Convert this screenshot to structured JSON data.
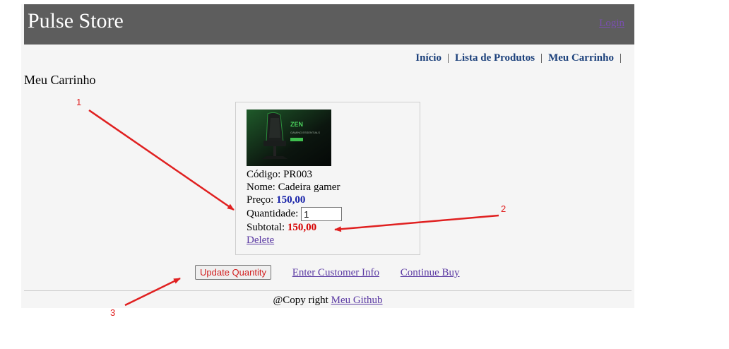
{
  "header": {
    "brand": "Pulse Store",
    "login_label": "Login"
  },
  "nav": {
    "items": [
      "Início",
      "Lista de Produtos",
      "Meu Carrinho"
    ]
  },
  "page_title": "Meu Carrinho",
  "cart_item": {
    "code_label": "Código:",
    "code": "PR003",
    "name_label": "Nome:",
    "name": "Cadeira gamer",
    "price_label": "Preço:",
    "price": "150,00",
    "quantity_label": "Quantidade:",
    "quantity": "1",
    "subtotal_label": "Subtotal:",
    "subtotal": "150,00",
    "delete_label": "Delete",
    "image_text": "ZEN",
    "image_subtext": "GAMING ESSENTIALS"
  },
  "actions": {
    "update_label": "Update Quantity",
    "customer_info_label": "Enter Customer Info",
    "continue_label": "Continue Buy"
  },
  "footer": {
    "copyright_text": "@Copy right",
    "github_label": "Meu Github"
  },
  "annotations": {
    "labels": [
      "1",
      "2",
      "3"
    ],
    "color": "#e02020"
  },
  "colors": {
    "header_bg": "#5d5d5d",
    "nav_link": "#1a3f7a",
    "price": "#1621a8",
    "subtotal": "#d60000",
    "link_visited": "#5b3aa3",
    "annotation": "#e02020"
  }
}
